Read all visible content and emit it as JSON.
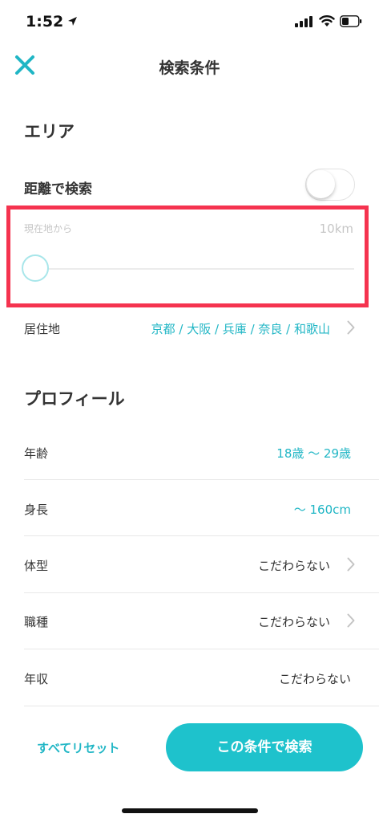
{
  "status_bar": {
    "time": "1:52"
  },
  "nav": {
    "title": "検索条件"
  },
  "area": {
    "title": "エリア",
    "distance_label": "距離で検索",
    "distance_enabled": false,
    "slider_label": "現在地から",
    "slider_value": "10km",
    "residence_label": "居住地",
    "residence_value": "京都 / 大阪 / 兵庫 / 奈良 / 和歌山"
  },
  "profile": {
    "title": "プロフィール",
    "rows": [
      {
        "label": "年齢",
        "value": "18歳 〜 29歳"
      },
      {
        "label": "身長",
        "value": "〜 160cm"
      },
      {
        "label": "体型",
        "value": "こだわらない"
      },
      {
        "label": "職種",
        "value": "こだわらない"
      },
      {
        "label": "年収",
        "value": "こだわらない"
      }
    ]
  },
  "footer": {
    "reset_label": "すべてリセット",
    "search_label": "この条件で検索"
  },
  "colors": {
    "accent": "#20b6c5",
    "button": "#1ec2cc",
    "highlight": "#f5334f"
  }
}
